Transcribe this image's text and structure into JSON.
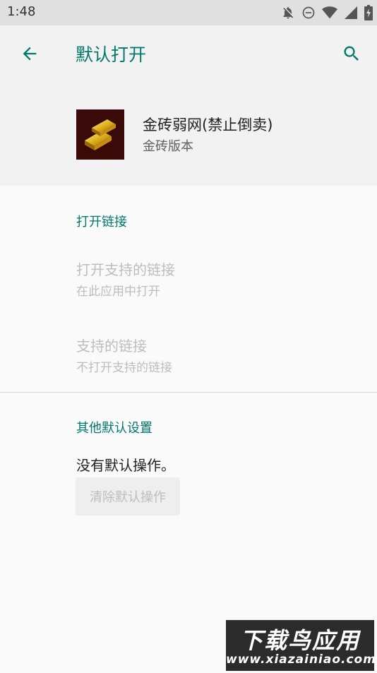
{
  "status_bar": {
    "time": "1:48",
    "icons": [
      "notifications-off-icon",
      "do-not-disturb-icon",
      "wifi-icon",
      "battery-icon"
    ]
  },
  "toolbar": {
    "title": "默认打开",
    "back_icon": "arrow-back-icon",
    "search_icon": "search-icon"
  },
  "app": {
    "name": "金砖弱网(禁止倒卖)",
    "version": "金砖版本"
  },
  "open_links": {
    "header": "打开链接",
    "items": [
      {
        "title": "打开支持的链接",
        "summary": "在此应用中打开"
      },
      {
        "title": "支持的链接",
        "summary": "不打开支持的链接"
      }
    ]
  },
  "other_defaults": {
    "header": "其他默认设置",
    "message": "没有默认操作。",
    "clear_button": "清除默认操作"
  },
  "watermark": {
    "main": "下载鸟应用",
    "url": "www.xiazainiao.com"
  },
  "colors": {
    "accent": "#00796b",
    "disabled_text": "#bdbdbd",
    "header_bg": "#f2f2f2",
    "page_bg": "#fafafa"
  }
}
